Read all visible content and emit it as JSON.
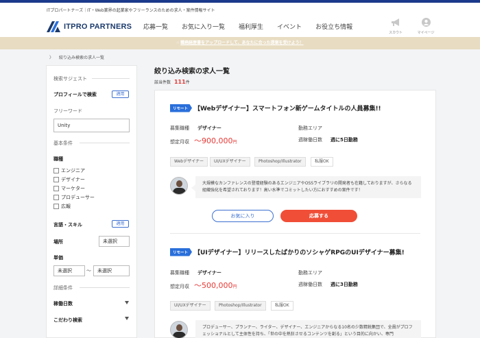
{
  "header": {
    "tagline": "ITプロパートナーズ｜IT・Web業界の起業家やフリーランスのための求人・案件情報サイト",
    "logo_text": "ITPRO PARTNERS",
    "nav": [
      "応募一覧",
      "お気に入り一覧",
      "福利厚生",
      "イベント",
      "お役立ち情報"
    ],
    "scout_label": "スカウト",
    "mypage_label": "マイページ"
  },
  "banner": {
    "text": "職務経歴書をアップロードして、あなたに合った提案を受けよう！"
  },
  "breadcrumb": {
    "separator": "〉",
    "current": "絞り込み検索の求人一覧"
  },
  "sidebar": {
    "search_suggest": "検索サジェスト",
    "profile_search": "プロフィールで検索",
    "apply_label": "適用",
    "freeword_label": "フリーワード",
    "freeword_value": "Unity",
    "basic_conditions": "基本条件",
    "job_type_label": "職種",
    "job_types": [
      "エンジニア",
      "デザイナー",
      "マーケター",
      "プロデューサー",
      "広報"
    ],
    "language_skill_label": "言語・スキル",
    "location_label": "場所",
    "location_value": "未選択",
    "unit_price_label": "単価",
    "price_min": "未選択",
    "price_sep": "〜",
    "price_max": "未選択",
    "detail_conditions": "詳細条件",
    "work_days_label": "稼働日数",
    "particular_label": "こだわり検索"
  },
  "main": {
    "title": "絞り込み検索の求人一覧",
    "count_prefix": "該当件数",
    "count_value": "111",
    "count_suffix": "件",
    "jobs": [
      {
        "badge": "リモート",
        "title": "【Webデザイナー】スマートフォン新ゲームタイトルの人員募集!!",
        "role_label": "募集職種",
        "role_value": "デザイナー",
        "salary_label": "想定月収",
        "salary_value": "〜900,000",
        "salary_unit": "円",
        "area_label": "勤務エリア",
        "area_value": "",
        "days_label": "週稼働日数",
        "days_value": "週に5日勤務",
        "tags": [
          "Webデザイナー",
          "UI/UXデザイナー",
          "Photoshop/Illustrator",
          "私服OK"
        ],
        "description": "大規模なカンファレンスの登壇経験のあるエンジニアやOSSライブラリの開発者も在籍しておりますが、さらなる組織強化を希望されております！高い水準でコミットしたい方におすすめの案件です！",
        "fav_label": "お気に入り",
        "apply_label": "応募する"
      },
      {
        "badge": "リモート",
        "title": "【UIデザイナー】リリースしたばかりのソシャゲRPGのUIデザイナー募集!",
        "role_label": "募集職種",
        "role_value": "デザイナー",
        "salary_label": "想定月収",
        "salary_value": "〜500,000",
        "salary_unit": "円",
        "area_label": "勤務エリア",
        "area_value": "",
        "days_label": "週稼働日数",
        "days_value": "週に3日勤務",
        "tags": [
          "UI/UXデザイナー",
          "Photoshop/Illustrator",
          "私服OK"
        ],
        "description": "プロデューサー、プランナー、ライター、デザイナー、エンジニアからなる10名の少数精鋭集団で、全員がプロフェッショナルとして主体性を持ち、「世の中を熱狂させるコンテンツを創る」という目的に向かい、専門"
      }
    ]
  },
  "colors": {
    "accent_blue": "#2a6fdb",
    "price_red": "#e53935",
    "apply_red": "#f04e37",
    "banner_beige": "#e8dcc2",
    "brand_navy": "#1b3a6b"
  }
}
